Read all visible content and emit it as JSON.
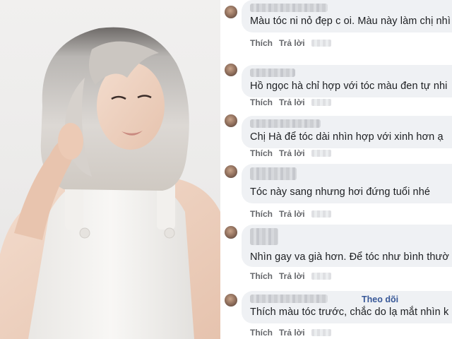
{
  "comments": [
    {
      "text": "Màu tóc ni nỏ đẹp c oi. Màu này làm chị nhì",
      "like": "Thích",
      "reply": "Trả lời"
    },
    {
      "text": "Hồ ngọc hà chỉ hợp với tóc màu đen tự nhi",
      "like": "Thích",
      "reply": "Trả lời"
    },
    {
      "text": "Chị Hà để tóc dài nhìn hợp với xinh hơn ạ",
      "like": "Thích",
      "reply": "Trả lời"
    },
    {
      "text": "Tóc này sang nhưng hơi đứng tuổi nhé",
      "like": "Thích",
      "reply": "Trả lời"
    },
    {
      "text": "Nhìn gay va già hơn. Để tóc như bình thườ",
      "like": "Thích",
      "reply": "Trả lời"
    },
    {
      "text": "Thích màu tóc trước, chắc do lạ mắt nhìn k",
      "like": "Thích",
      "reply": "Trả lời",
      "follow": "Theo dõi"
    }
  ],
  "colors": {
    "bubble": "#eff1f4",
    "text": "#1c1e21",
    "action": "#65676b",
    "follow": "#385898"
  }
}
